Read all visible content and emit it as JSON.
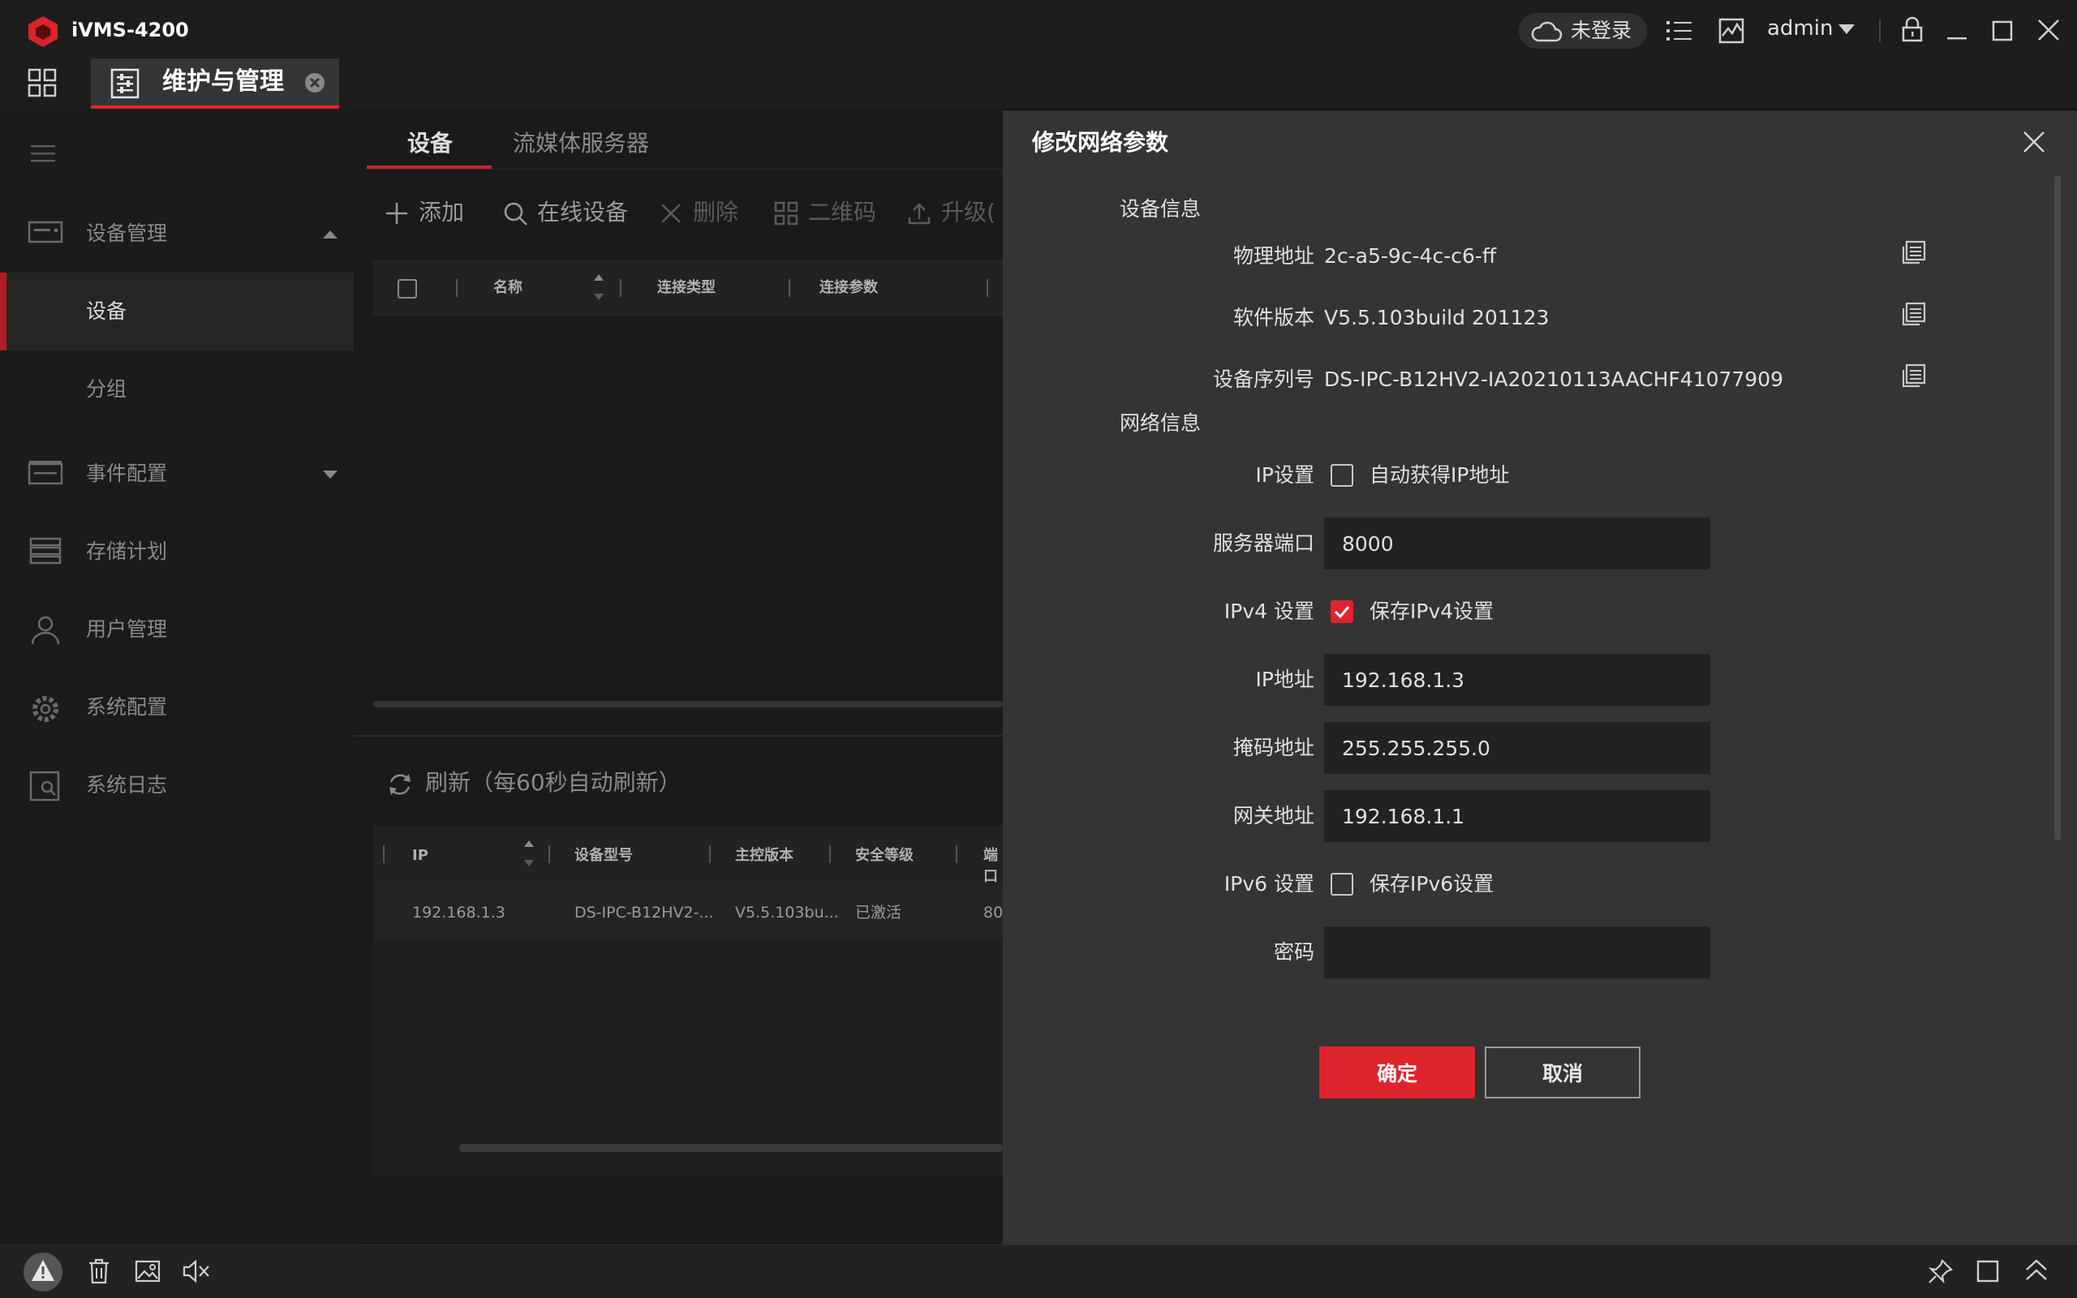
{
  "app": {
    "title": "iVMS-4200",
    "tab_label": "维护与管理"
  },
  "header": {
    "cloud_status": "未登录",
    "user": "admin"
  },
  "sidebar": {
    "items": [
      {
        "label": "设备管理"
      },
      {
        "label": "设备"
      },
      {
        "label": "分组"
      },
      {
        "label": "事件配置"
      },
      {
        "label": "存储计划"
      },
      {
        "label": "用户管理"
      },
      {
        "label": "系统配置"
      },
      {
        "label": "系统日志"
      }
    ]
  },
  "center": {
    "tabs": [
      {
        "label": "设备"
      },
      {
        "label": "流媒体服务器"
      }
    ],
    "toolbar": {
      "add": "添加",
      "online": "在线设备",
      "delete": "删除",
      "qrcode": "二维码",
      "upgrade": "升级("
    },
    "device_table": {
      "columns": [
        "名称",
        "连接类型",
        "连接参数"
      ]
    },
    "refresh_label": "刷新（每60秒自动刷新）",
    "online_table": {
      "columns": [
        "IP",
        "设备型号",
        "主控版本",
        "安全等级",
        "端口"
      ],
      "rows": [
        [
          "192.168.1.3",
          "DS-IPC-B12HV2-...",
          "V5.5.103bu...",
          "已激活",
          "80"
        ]
      ]
    }
  },
  "dialog": {
    "title": "修改网络参数",
    "device_info_section": "设备信息",
    "mac_label": "物理地址",
    "mac_value": "2c-a5-9c-4c-c6-ff",
    "sw_label": "软件版本",
    "sw_value": "V5.5.103build 201123",
    "serial_label": "设备序列号",
    "serial_value": "DS-IPC-B12HV2-IA20210113AACHF41077909",
    "network_section": "网络信息",
    "ip_setting_label": "IP设置",
    "dhcp_label": "自动获得IP地址",
    "dhcp_checked": false,
    "port_label": "服务器端口",
    "port_value": "8000",
    "ipv4_label": "IPv4 设置",
    "ipv4_keep_label": "保存IPv4设置",
    "ipv4_checked": true,
    "ip_label": "IP地址",
    "ip_value": "192.168.1.3",
    "mask_label": "掩码地址",
    "mask_value": "255.255.255.0",
    "gateway_label": "网关地址",
    "gateway_value": "192.168.1.1",
    "ipv6_label": "IPv6 设置",
    "ipv6_keep_label": "保存IPv6设置",
    "ipv6_checked": false,
    "password_label": "密码",
    "password_value": "",
    "ok_label": "确定",
    "cancel_label": "取消"
  },
  "colors": {
    "accent": "#e0242e",
    "background": "#141414",
    "dialog": "#343434"
  },
  "icons": [
    "app-logo-icon",
    "cloud-icon",
    "list-icon",
    "monitor-icon",
    "chevron-down-icon",
    "lock-icon",
    "minimize-icon",
    "maximize-icon",
    "close-icon",
    "apps-grid-icon",
    "maintenance-icon",
    "close-circle-icon",
    "menu-icon",
    "device-icon",
    "event-icon",
    "storage-icon",
    "user-icon",
    "gear-icon",
    "log-icon",
    "plus-icon",
    "search-icon",
    "delete-icon",
    "qrcode-icon",
    "upload-icon",
    "refresh-icon",
    "copy-icon",
    "alert-icon",
    "trash-icon",
    "image-icon",
    "mute-icon",
    "pin-icon",
    "window-icon",
    "double-chevron-up-icon"
  ]
}
